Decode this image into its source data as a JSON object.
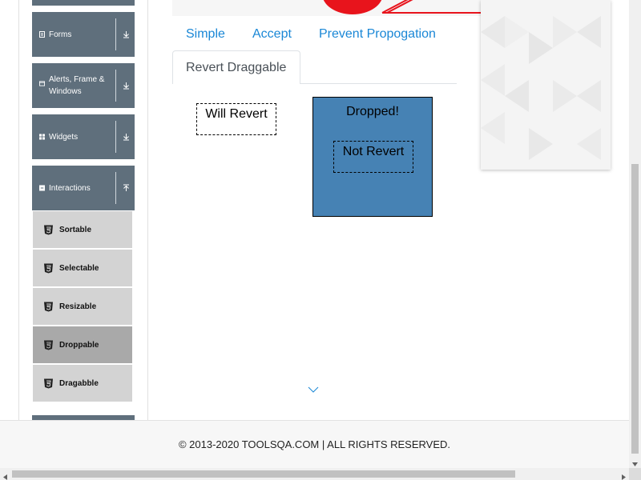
{
  "sidebar": {
    "groups": [
      {
        "label": "Forms",
        "icon": "form-icon",
        "state": "collapsed"
      },
      {
        "label": "Alerts, Frame & Windows",
        "icon": "window-icon",
        "state": "collapsed"
      },
      {
        "label": "Widgets",
        "icon": "grid-icon",
        "state": "collapsed"
      },
      {
        "label": "Interactions",
        "icon": "square-icon",
        "state": "expanded"
      }
    ],
    "items": [
      {
        "label": "Sortable",
        "icon": "html5-icon"
      },
      {
        "label": "Selectable",
        "icon": "html5-icon"
      },
      {
        "label": "Resizable",
        "icon": "html5-icon"
      },
      {
        "label": "Droppable",
        "icon": "html5-icon",
        "active": true
      },
      {
        "label": "Dragabble",
        "icon": "html5-icon"
      }
    ]
  },
  "tabs": [
    {
      "label": "Simple"
    },
    {
      "label": "Accept"
    },
    {
      "label": "Prevent Propogation"
    },
    {
      "label": "Revert Draggable",
      "active": true
    }
  ],
  "content": {
    "will_revert": "Will Revert",
    "drop_text": "Dropped!",
    "not_revert": "Not Revert"
  },
  "footer": {
    "text": "© 2013-2020 TOOLSQA.COM | ALL RIGHTS RESERVED."
  },
  "colors": {
    "sidebar_header": "#5f6f7c",
    "sub_item": "#d3d3d3",
    "sub_item_active": "#a9a9a9",
    "link": "#1a87d6",
    "drop_box": "#4682b4"
  }
}
